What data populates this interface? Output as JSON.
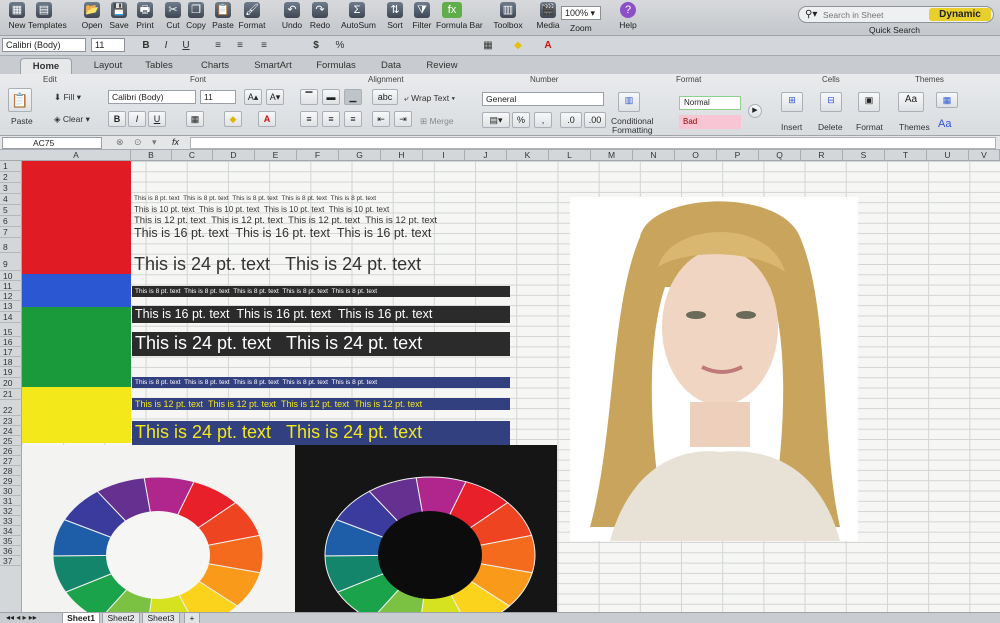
{
  "toolbar": {
    "buttons": [
      "New",
      "Templates",
      "Open",
      "Save",
      "Print",
      "Cut",
      "Copy",
      "Paste",
      "Format",
      "Undo",
      "Redo",
      "AutoSum",
      "Sort",
      "Filter",
      "Formula Bar",
      "Toolbox",
      "Media",
      "Zoom",
      "Help"
    ],
    "icons": [
      "new-icon",
      "templates-icon",
      "open-icon",
      "save-icon",
      "print-icon",
      "cut-icon",
      "copy-icon",
      "paste-icon",
      "format-icon",
      "undo-icon",
      "redo-icon",
      "autosum-icon",
      "sort-icon",
      "filter-icon",
      "formula-bar-icon",
      "toolbox-icon",
      "media-icon",
      "zoom-icon",
      "help-icon"
    ],
    "zoom": "100%",
    "search_placeholder": "Search in Sheet",
    "dynamic_label": "Dynamic",
    "quick_search": "Quick Search"
  },
  "format_bar": {
    "font": "Calibri (Body)",
    "size": "11",
    "bold": "B",
    "italic": "I",
    "underline": "U",
    "currency": "$",
    "percent": "%"
  },
  "ribbon": {
    "tabs": [
      "Home",
      "Layout",
      "Tables",
      "Charts",
      "SmartArt",
      "Formulas",
      "Data",
      "Review"
    ],
    "active_tab": "Home",
    "groups": [
      "Edit",
      "Font",
      "Alignment",
      "Number",
      "Format",
      "Cells",
      "Themes"
    ],
    "edit": {
      "paste": "Paste",
      "fill": "Fill",
      "clear": "Clear"
    },
    "font": {
      "name": "Calibri (Body)",
      "size": "11"
    },
    "alignment": {
      "wrap_text": "Wrap Text",
      "merge": "Merge",
      "orientation": "abc"
    },
    "number": {
      "format": "General",
      "conditional": "Conditional",
      "formatting": "Formatting"
    },
    "styles": {
      "normal": "Normal",
      "bad": "Bad"
    },
    "cells": {
      "insert": "Insert",
      "delete": "Delete",
      "format": "Format"
    },
    "themes": {
      "label": "Themes",
      "sample": "Aa"
    }
  },
  "formula_bar": {
    "cell_ref": "AC75",
    "fx": "fx"
  },
  "grid": {
    "columns": [
      "A",
      "B",
      "C",
      "D",
      "E",
      "F",
      "G",
      "H",
      "I",
      "J",
      "K",
      "L",
      "M",
      "N",
      "O",
      "P",
      "Q",
      "R",
      "S",
      "T",
      "U",
      "V"
    ],
    "rows": [
      "1",
      "2",
      "3",
      "4",
      "5",
      "6",
      "7",
      "8",
      "9",
      "10",
      "11",
      "12",
      "13",
      "14",
      "15",
      "16",
      "17",
      "18",
      "19",
      "20",
      "21",
      "22",
      "23",
      "24",
      "25",
      "26",
      "27",
      "28",
      "29",
      "30",
      "31",
      "32",
      "33",
      "34",
      "35",
      "36",
      "37"
    ],
    "colors": {
      "red": "#e01b24",
      "blue": "#2c57d3",
      "green": "#1a9a3a",
      "yellow": "#f2e81a",
      "dark": "#2b2b2b",
      "navy": "#33407f"
    },
    "text_lines": {
      "pt8": "This is 8 pt. text",
      "pt10": "This is 10 pt. text",
      "pt12": "This is 12 pt. text",
      "pt16": "This is 16 pt. text",
      "pt24": "This is 24 pt. text"
    }
  },
  "sheets": [
    "Sheet1",
    "Sheet2",
    "Sheet3"
  ],
  "active_sheet": "Sheet1"
}
